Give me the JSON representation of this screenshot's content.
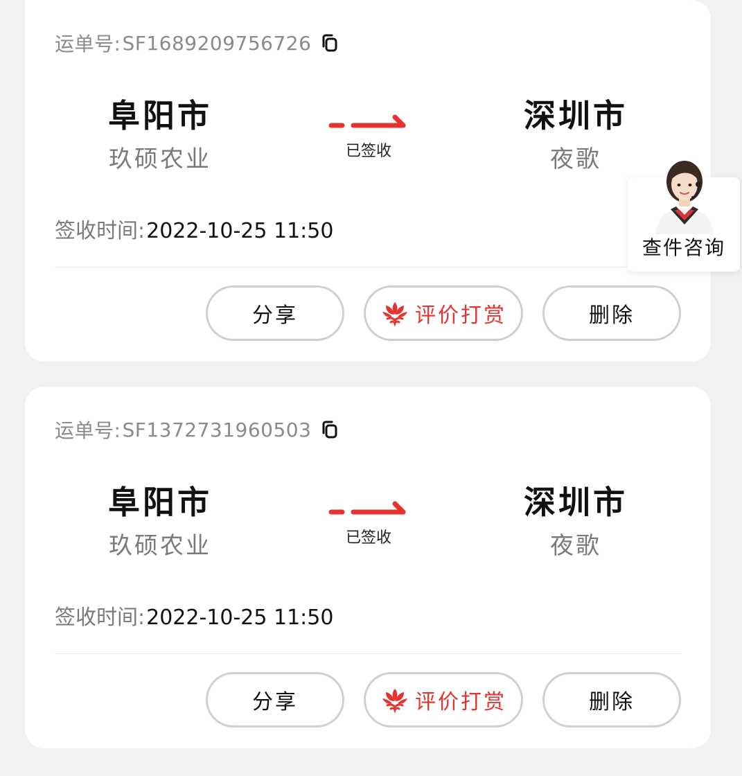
{
  "labels": {
    "waybill": "运单号:",
    "sign_time": "签收时间:"
  },
  "buttons": {
    "share": "分享",
    "reward": "评价打赏",
    "delete": "删除"
  },
  "shipments": [
    {
      "waybill_number": "SF1689209756726",
      "from_city": "阜阳市",
      "from_company": "玖硕农业",
      "to_city": "深圳市",
      "to_company": "夜歌",
      "status": "已签收",
      "sign_time": "2022-10-25 11:50"
    },
    {
      "waybill_number": "SF1372731960503",
      "from_city": "阜阳市",
      "from_company": "玖硕农业",
      "to_city": "深圳市",
      "to_company": "夜歌",
      "status": "已签收",
      "sign_time": "2022-10-25 11:50"
    }
  ],
  "support_widget": {
    "label": "查件咨询",
    "avatar_icon": "customer-service-agent-avatar"
  },
  "colors": {
    "accent_red": "#e5332f",
    "background": "#f1f1f1",
    "card": "#ffffff"
  },
  "icons": {
    "copy": "copy-icon",
    "route_arrow": "arrow-right-icon",
    "reward": "lotus-icon"
  }
}
